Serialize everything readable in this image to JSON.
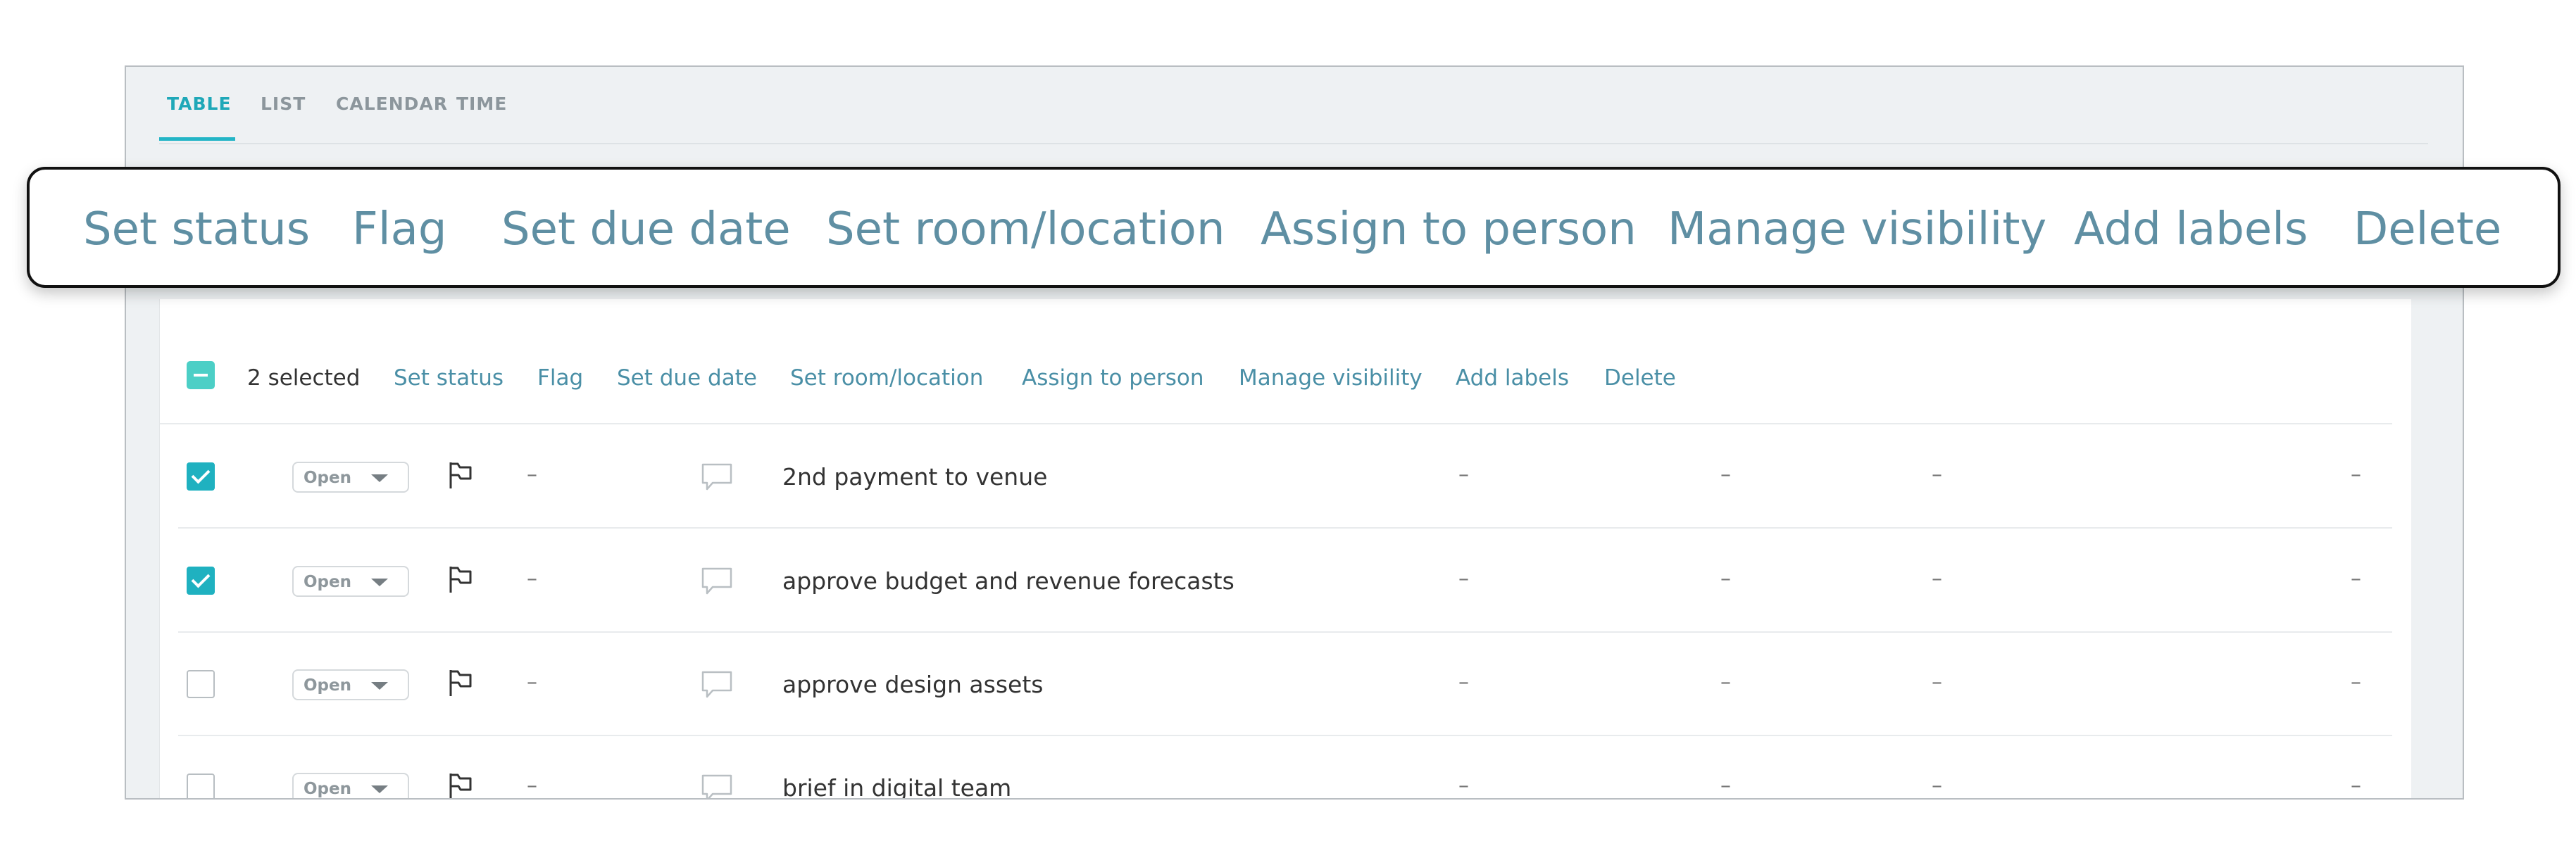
{
  "tabs": [
    "TABLE",
    "LIST",
    "CALENDAR",
    "TIME"
  ],
  "bulk": {
    "selected_text": "2 selected",
    "actions": [
      "Set status",
      "Flag",
      "Set due date",
      "Set room/location",
      "Assign to person",
      "Manage visibility",
      "Add labels",
      "Delete"
    ]
  },
  "callout": {
    "actions": [
      "Set status",
      "Flag",
      "Set due date",
      "Set room/location",
      "Assign to person",
      "Manage visibility",
      "Add labels",
      "Delete"
    ]
  },
  "rows": [
    {
      "checked": true,
      "status": "Open",
      "due": "–",
      "name": "2nd payment to venue",
      "c1": "–",
      "c2": "–",
      "c3": "–",
      "c4": "–"
    },
    {
      "checked": true,
      "status": "Open",
      "due": "–",
      "name": "approve budget and revenue forecasts",
      "c1": "–",
      "c2": "–",
      "c3": "–",
      "c4": "–"
    },
    {
      "checked": false,
      "status": "Open",
      "due": "–",
      "name": "approve design assets",
      "c1": "–",
      "c2": "–",
      "c3": "–",
      "c4": "–"
    },
    {
      "checked": false,
      "status": "Open",
      "due": "–",
      "name": "brief in digital team",
      "c1": "–",
      "c2": "–",
      "c3": "–",
      "c4": "–"
    }
  ],
  "colors": {
    "accent": "#23b5c6",
    "action_link": "#4a8fa6",
    "checkbox_on": "#1fb1c0",
    "bulk_checkbox": "#4ccfc6"
  }
}
